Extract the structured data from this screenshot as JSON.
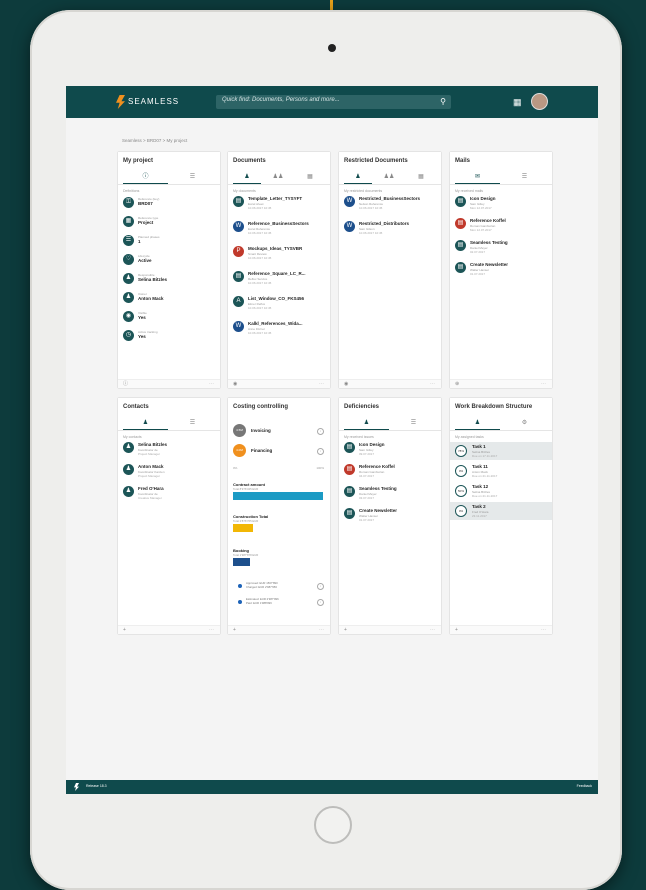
{
  "app": {
    "brand": "SEAMLESS",
    "search_placeholder": "Quick find: Documents, Persons and more...",
    "breadcrumb": "Seamless > BRD07 > My project"
  },
  "colors": {
    "primary": "#0f4a4c",
    "accent": "#f0901e",
    "blue": "#1d63b8",
    "yellow": "#f2b705",
    "teal_bar": "#1b9ac4"
  },
  "my_project": {
    "title": "My project",
    "subhead": "Definitions",
    "rows": [
      {
        "label": "Reference (key)",
        "value": "BRD07",
        "icon": "key-icon"
      },
      {
        "label": "Reference type",
        "value": "Project",
        "icon": "folder-icon"
      },
      {
        "label": "Planned phases",
        "value": "1",
        "icon": "phase-icon"
      },
      {
        "label": "Lifecycle",
        "value": "Active",
        "icon": "heart-icon"
      },
      {
        "label": "Responsible",
        "value": "Selina Bitzles",
        "icon": "person-icon"
      },
      {
        "label": "Owner",
        "value": "Anton Mack",
        "icon": "person-icon"
      },
      {
        "label": "Visible",
        "value": "Yes",
        "icon": "eye-icon"
      },
      {
        "label": "Active tracking",
        "value": "Yes",
        "icon": "clock-icon"
      }
    ]
  },
  "documents": {
    "title": "Documents",
    "subhead": "My documents",
    "rows": [
      {
        "name": "Template_Letter_TYSYFT",
        "sub": "Excel sheet",
        "date": "10.06.2017 10:45",
        "icon": "doc-icon",
        "color": "teal"
      },
      {
        "name": "Reference_BusinessSectors",
        "sub": "Excel Reference",
        "date": "10.06.2017 10:45",
        "icon": "word-icon",
        "color": "blue"
      },
      {
        "name": "Mockups_Ideas_TYSVBR",
        "sub": "Smart Review",
        "date": "10.06.2017 10:45",
        "icon": "ppt-icon",
        "color": "red"
      },
      {
        "name": "Reference_Square_LC_R...",
        "sub": "Reflux Service",
        "date": "10.06.2017 10:45",
        "icon": "doc-icon",
        "color": "teal"
      },
      {
        "name": "List_Window_CO_FKS456",
        "sub": "Elmer Reflux",
        "date": "10.06.2017 10:45",
        "icon": "pdf-icon",
        "color": "teal"
      },
      {
        "name": "Kalkl_References_Wida...",
        "sub": "Anne Fitzner",
        "date": "10.06.2017 10:45",
        "icon": "word-icon",
        "color": "blue"
      }
    ]
  },
  "restricted": {
    "title": "Restricted Documents",
    "subhead": "My restricted documents",
    "rows": [
      {
        "name": "Restricted_BusinessSectors",
        "sub": "Nelson Reference",
        "date": "10.06.2017 10:45",
        "icon": "word-icon"
      },
      {
        "name": "Restricted_Distributors",
        "sub": "Sam Gilson",
        "date": "10.06.2017 10:45",
        "icon": "word-icon"
      }
    ]
  },
  "mails": {
    "title": "Mails",
    "subhead": "My received mails",
    "rows": [
      {
        "name": "Icon Design",
        "sub": "Sam Gilley",
        "date": "Mon 12.07.2017",
        "icon": "mail-icon",
        "color": "teal"
      },
      {
        "name": "Reference Koffel",
        "sub": "Roman Gamburian",
        "date": "Mon 12.07.2017",
        "icon": "mail-icon",
        "color": "red"
      },
      {
        "name": "Seamless Testing",
        "sub": "Daniel Meyer",
        "date": "02.07.2017",
        "icon": "mail-icon",
        "color": "teal"
      },
      {
        "name": "Create Newsletter",
        "sub": "Walter Hanser",
        "date": "01.07.2017",
        "icon": "mail-icon",
        "color": "teal"
      }
    ]
  },
  "contacts": {
    "title": "Contacts",
    "subhead": "My contacts",
    "rows": [
      {
        "name": "Selina Bitzles",
        "sub": "Koordinator de",
        "date": "Project Manager"
      },
      {
        "name": "Anton Mack",
        "sub": "Koordinator Kanzen",
        "date": "Project Manager"
      },
      {
        "name": "Fred O'Hara",
        "sub": "Koordinator de",
        "date": "Creative Manager"
      }
    ]
  },
  "cost": {
    "title": "Costing controlling",
    "items": [
      {
        "badge": "4.5M",
        "label": "Invoicing"
      },
      {
        "badge": "4.0M",
        "label": "Financing"
      }
    ],
    "range_min": "0%",
    "range_max": "100%",
    "bars": [
      {
        "title": "Contract amount",
        "sub": "Total 8'976'345 EUR",
        "fraction": 1.0,
        "color": "#1b9ac4"
      },
      {
        "title": "Construction Total",
        "sub": "Total 2'876'765 EUR",
        "fraction": 0.22,
        "color": "#f2b705"
      },
      {
        "title": "Booking",
        "sub": "Total 1'987'878 EUR",
        "fraction": 0.19,
        "color": "#1d4f8c"
      }
    ],
    "legend": [
      {
        "l1": "Approved: EUR 1567'890",
        "l2": "Charged: EUR 2'987'956"
      },
      {
        "l1": "Estimated: EUR 2'987'996",
        "l2": "Paid: EUR 1'988'996"
      }
    ]
  },
  "deficiencies": {
    "title": "Deficiencies",
    "subhead": "My received issues",
    "rows": [
      {
        "name": "Icon Design",
        "sub": "Sam Gilley",
        "date": "09.07.2017",
        "color": "teal"
      },
      {
        "name": "Reference Koffel",
        "sub": "Roman Gamburian",
        "date": "04.07.2017",
        "color": "red"
      },
      {
        "name": "Seamless Testing",
        "sub": "Daniel Meyer",
        "date": "03.07.2017",
        "color": "teal"
      },
      {
        "name": "Create Newsletter",
        "sub": "Walter Hanser",
        "date": "01.07.2017",
        "color": "teal"
      }
    ]
  },
  "wbs": {
    "title": "Work Breakdown Structure",
    "subhead": "My assigned tasks",
    "rows": [
      {
        "pct": "78%",
        "name": "Task 1",
        "sub": "Selina Bitzles",
        "date": "Due on 17.11.2017",
        "selected": true
      },
      {
        "pct": "0%",
        "name": "Task 11",
        "sub": "Anton Mack",
        "date": "Due on 21.11.2017",
        "selected": false
      },
      {
        "pct": "50%",
        "name": "Task 12",
        "sub": "Selina Bitzles",
        "date": "Due on 21.11.2017",
        "selected": false
      },
      {
        "pct": "0%",
        "name": "Task 2",
        "sub": "Fred O'Hara",
        "date": "23.11.2017",
        "selected": true
      }
    ]
  },
  "footer": {
    "version": "Release 18.3",
    "feedback": "Feedback"
  }
}
